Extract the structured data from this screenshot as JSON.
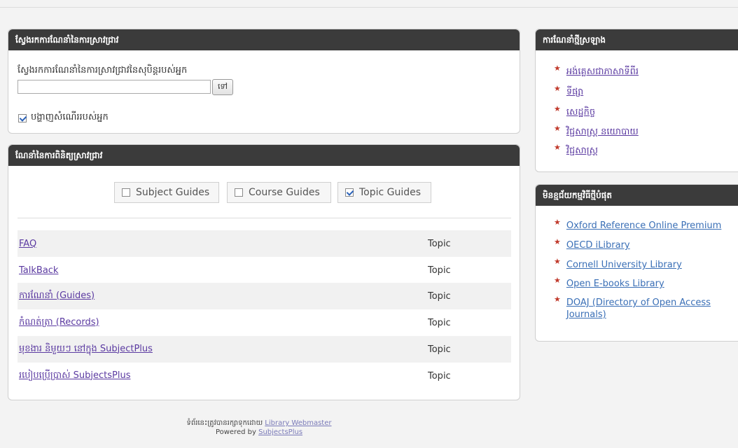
{
  "search": {
    "header": "ស្វែងរកការណែនាំនៃការស្រាវជ្រាវ",
    "label": "ស្វែងរកការណែនាំនៃការស្រាវជ្រាវនៃសុបិន្តរបស់អ្នក",
    "input_value": "",
    "button_label": "ទៅ",
    "history_label": "បង្ហាញសំណើររបស់អ្នក",
    "history_checked": true
  },
  "guides": {
    "header": "ណែនាំនៃការពិនិត្យស្រាវជ្រាវ",
    "filters": [
      {
        "label": "Subject Guides",
        "checked": false
      },
      {
        "label": "Course Guides",
        "checked": false
      },
      {
        "label": "Topic Guides",
        "checked": true
      }
    ],
    "rows": [
      {
        "title": "FAQ",
        "type": "Topic"
      },
      {
        "title": "TalkBack",
        "type": "Topic"
      },
      {
        "title": "ការណែនាំ (Guides)",
        "type": "Topic"
      },
      {
        "title": "កំណត់ត្រា (Records)",
        "type": "Topic"
      },
      {
        "title": "មុខងារ និមួយៗ នៅក្នុង SubjectPlus",
        "type": "Topic"
      },
      {
        "title": "របៀបប្រើប្រាស់ SubjectsPlus",
        "type": "Topic"
      }
    ]
  },
  "new_guides": {
    "header": "ការណែនាំថ្មីស្រឡាង",
    "items": [
      "អង់គ្លេសជាភាសាទីពីរ",
      "ទីផ្សា",
      "សេដ្ឋកិច្ច",
      "វិជ្ជសាស្ត្រ នយោបាយ",
      "វិជ្ជសាស្ត្រ"
    ]
  },
  "new_databases": {
    "header": "មិនខ្មជ័យកម្មវិធីថ្មីបំផុត",
    "items": [
      "Oxford Reference Online Premium",
      "OECD iLibrary",
      "Cornell University Library",
      "Open E-books Library",
      "DOAJ (Directory of Open Access Journals)"
    ]
  },
  "footer": {
    "maintained_text": "ទំព័រនេះត្រូវបានរក្សាទុកដោយ",
    "webmaster_link": "Library Webmaster",
    "powered_text": "Powered by",
    "powered_link": "SubjectsPlus"
  },
  "colors": {
    "header_bg": "#3b3b3b",
    "link": "#5b3aa1",
    "db_link": "#3a6fb6",
    "star": "#c0392b"
  }
}
